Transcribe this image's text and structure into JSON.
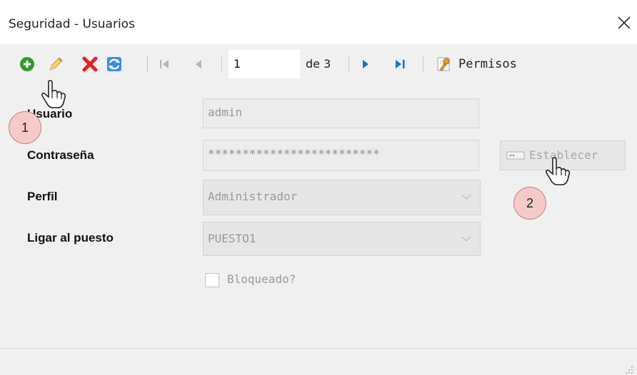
{
  "window": {
    "title": "Seguridad - Usuarios"
  },
  "toolbar": {
    "icons": [
      "add-icon",
      "edit-icon",
      "delete-icon",
      "refresh-icon",
      "first-record-icon",
      "previous-record-icon",
      "next-record-icon",
      "last-record-icon",
      "permissions-key-icon"
    ],
    "record_current": "1",
    "record_total_text": "de 3",
    "permissions_label": "Permisos"
  },
  "form": {
    "usuario_label": "Usuario",
    "usuario_value": "admin",
    "contrasena_label": "Contraseña",
    "contrasena_value": "*************************",
    "establecer_label": "Establecer",
    "perfil_label": "Perfil",
    "perfil_value": "Administrador",
    "puesto_label": "Ligar al puesto",
    "puesto_value": "PUESTO1",
    "bloqueado_label": "Bloqueado?",
    "bloqueado_checked": false
  },
  "annotations": [
    {
      "number": "1",
      "target": "edit-button"
    },
    {
      "number": "2",
      "target": "establecer-button"
    }
  ],
  "colors": {
    "add_green": "#2e9b2e",
    "delete_red": "#e02020",
    "nav_blue": "#1a6fd6",
    "badge_fill": "#f7caca",
    "badge_border": "#c88080"
  }
}
